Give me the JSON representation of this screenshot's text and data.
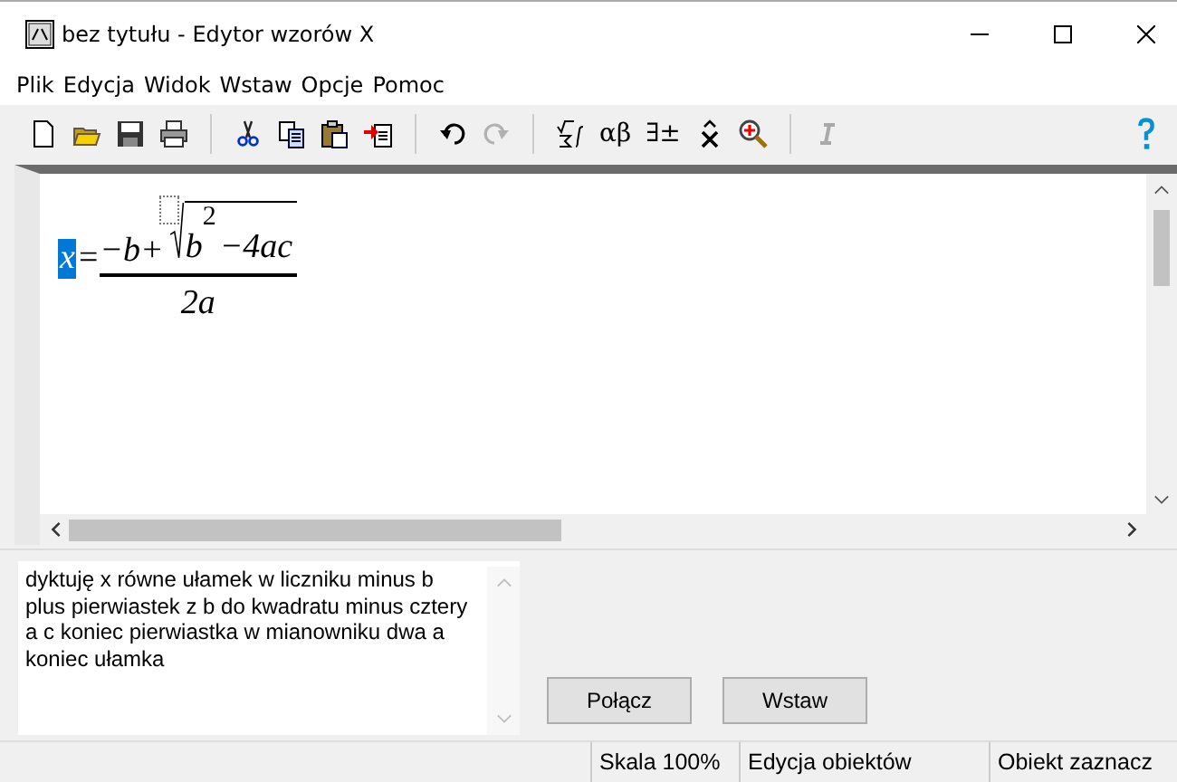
{
  "window": {
    "title": "bez tytułu - Edytor wzorów X"
  },
  "menu": [
    "Plik",
    "Edycja",
    "Widok",
    "Wstaw",
    "Opcje",
    "Pomoc"
  ],
  "toolbar": [
    {
      "kind": "new",
      "disabled": false
    },
    {
      "kind": "open",
      "disabled": false
    },
    {
      "kind": "save",
      "disabled": false
    },
    {
      "kind": "print",
      "disabled": false
    },
    {
      "kind": "sep"
    },
    {
      "kind": "cut",
      "disabled": false
    },
    {
      "kind": "copy",
      "disabled": false
    },
    {
      "kind": "paste",
      "disabled": false
    },
    {
      "kind": "pastespecial",
      "disabled": false
    },
    {
      "kind": "sep"
    },
    {
      "kind": "undo",
      "disabled": false
    },
    {
      "kind": "redo",
      "disabled": true
    },
    {
      "kind": "sep"
    },
    {
      "kind": "templates",
      "disabled": false
    },
    {
      "kind": "text",
      "label": "αβ",
      "disabled": false
    },
    {
      "kind": "text",
      "label": "∃±",
      "disabled": false
    },
    {
      "kind": "accent",
      "disabled": false
    },
    {
      "kind": "zoom",
      "disabled": false
    },
    {
      "kind": "sep"
    },
    {
      "kind": "italic",
      "disabled": true
    }
  ],
  "formula": {
    "variable": {
      "text": "x",
      "selected": true
    },
    "equals": "=",
    "numerator_prefix": "−b+",
    "radicand_base": "b",
    "exponent": "2",
    "radicand_rest": "−4ac",
    "denominator": "2a"
  },
  "dictation": {
    "value": "dyktuję x równe ułamek w liczniku minus b plus pierwiastek z b do kwadratu minus cztery a c koniec pierwiastka w mianowniku dwa a koniec ułamka"
  },
  "buttons": [
    "Połącz",
    "Wstaw"
  ],
  "status_bar": [
    "Skala 100%",
    "Edycja obiektów",
    "Obiekt zaznacz"
  ]
}
